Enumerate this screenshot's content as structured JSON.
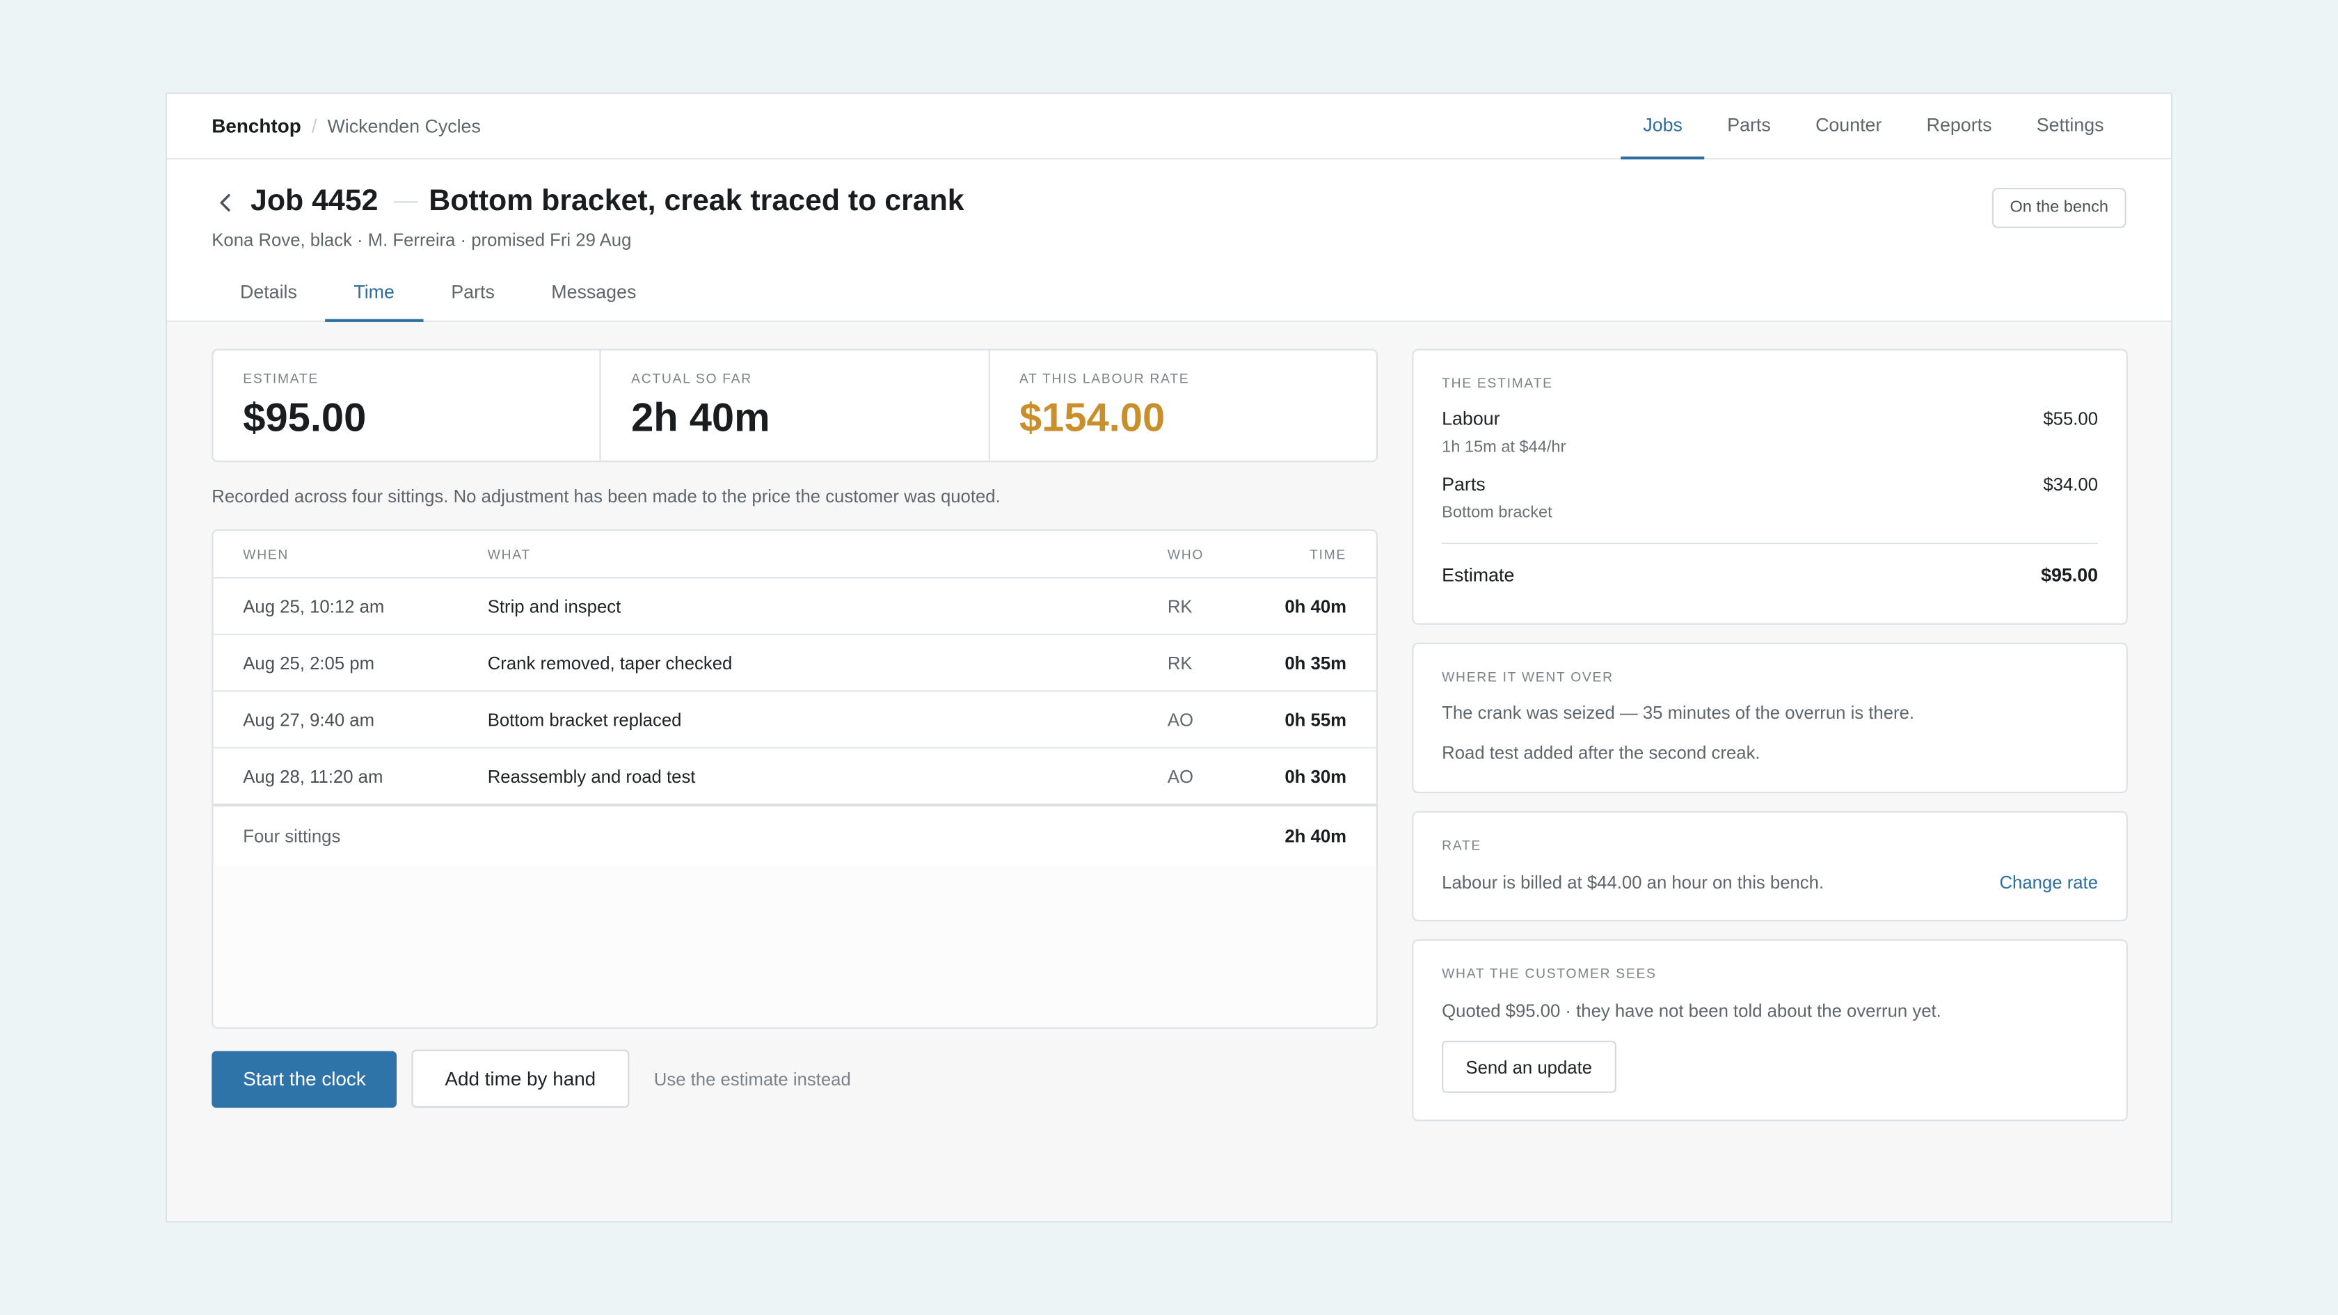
{
  "app": {
    "brand": "Benchtop",
    "separator": "/",
    "shop": "Wickenden Cycles"
  },
  "nav": {
    "items": [
      "Jobs",
      "Parts",
      "Counter",
      "Reports",
      "Settings"
    ],
    "active": "Jobs"
  },
  "job": {
    "number": "Job 4452",
    "title": "Bottom bracket, creak traced to crank",
    "subtitle": "Kona Rove, black · M. Ferreira · promised Fri 29 Aug",
    "status": "On the bench"
  },
  "tabs": {
    "items": [
      "Details",
      "Time",
      "Parts",
      "Messages"
    ],
    "active": "Time"
  },
  "stats": [
    {
      "label": "ESTIMATE",
      "value": "$95.00"
    },
    {
      "label": "ACTUAL SO FAR",
      "value": "2h 40m"
    },
    {
      "label": "AT THIS LABOUR RATE",
      "value": "$154.00",
      "color": "#c98f2c"
    }
  ],
  "note": "Recorded across four sittings. No adjustment has been made to the price the customer was quoted.",
  "time_table": {
    "headers": {
      "when": "WHEN",
      "what": "WHAT",
      "who": "WHO",
      "time": "TIME"
    },
    "rows": [
      {
        "when": "Aug 25, 10:12 am",
        "what": "Strip and inspect",
        "who": "RK",
        "time": "0h 40m"
      },
      {
        "when": "Aug 25, 2:05 pm",
        "what": "Crank removed, taper checked",
        "who": "RK",
        "time": "0h 35m"
      },
      {
        "when": "Aug 27, 9:40 am",
        "what": "Bottom bracket replaced",
        "who": "AO",
        "time": "0h 55m"
      },
      {
        "when": "Aug 28, 11:20 am",
        "what": "Reassembly and road test",
        "who": "AO",
        "time": "0h 30m"
      }
    ],
    "total": {
      "label": "Four sittings",
      "time": "2h 40m"
    }
  },
  "actions": {
    "start": "Start the clock",
    "add": "Add time by hand",
    "use_estimate": "Use the estimate instead"
  },
  "estimate_card": {
    "label": "THE ESTIMATE",
    "labour": {
      "name": "Labour",
      "amount": "$55.00",
      "detail": "1h 15m at $44/hr"
    },
    "parts": {
      "name": "Parts",
      "amount": "$34.00",
      "detail": "Bottom bracket"
    },
    "total": {
      "name": "Estimate",
      "amount": "$95.00"
    }
  },
  "over_card": {
    "label": "WHERE IT WENT OVER",
    "lines": [
      "The crank was seized — 35 minutes of the overrun is there.",
      "Road test added after the second creak."
    ]
  },
  "rate_card": {
    "label": "RATE",
    "text": "Labour is billed at $44.00 an hour on this bench.",
    "link": "Change rate"
  },
  "customer_card": {
    "label": "WHAT THE CUSTOMER SEES",
    "text": "Quoted $95.00 · they have not been told about the overrun yet.",
    "button": "Send an update"
  },
  "colors": {
    "accent": "#2c6e9e",
    "primary_button": "#2f74a9",
    "overrun": "#c98f2c",
    "background": "#edf4f6"
  },
  "icons": {
    "back": "chevron-left-icon"
  }
}
